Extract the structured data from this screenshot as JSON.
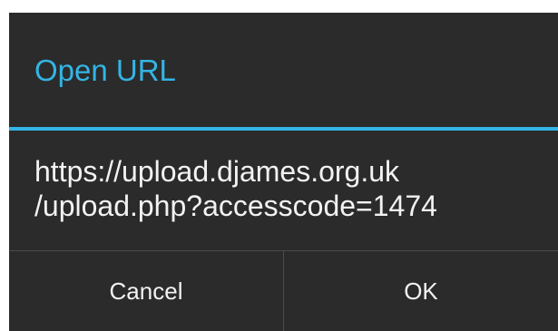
{
  "dialog": {
    "title": "Open URL",
    "url_line1": "https://upload.djames.org.uk",
    "url_line2": "/upload.php?accesscode=1474",
    "cancel_label": "Cancel",
    "ok_label": "OK",
    "accent_color": "#33b5e5",
    "background_color": "#2b2b2b"
  }
}
